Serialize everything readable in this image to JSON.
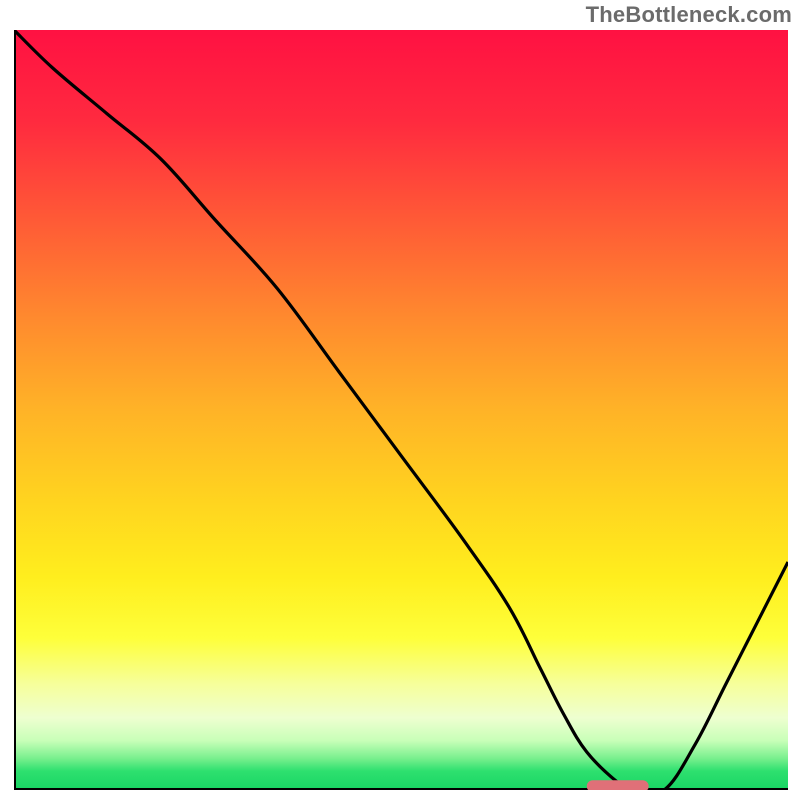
{
  "watermark": {
    "text": "TheBottleneck.com"
  },
  "colors": {
    "gradient_stops": [
      {
        "offset": 0.0,
        "color": "#ff1142"
      },
      {
        "offset": 0.12,
        "color": "#ff2a3f"
      },
      {
        "offset": 0.25,
        "color": "#ff5a36"
      },
      {
        "offset": 0.38,
        "color": "#ff8a2e"
      },
      {
        "offset": 0.5,
        "color": "#ffb327"
      },
      {
        "offset": 0.62,
        "color": "#ffd41f"
      },
      {
        "offset": 0.72,
        "color": "#ffee1e"
      },
      {
        "offset": 0.8,
        "color": "#feff3a"
      },
      {
        "offset": 0.86,
        "color": "#f6ff9a"
      },
      {
        "offset": 0.905,
        "color": "#eeffd0"
      },
      {
        "offset": 0.935,
        "color": "#c8ffb8"
      },
      {
        "offset": 0.958,
        "color": "#7af08e"
      },
      {
        "offset": 0.975,
        "color": "#2ee06f"
      },
      {
        "offset": 1.0,
        "color": "#18d563"
      }
    ],
    "curve_stroke": "#000000",
    "marker_fill": "#e07078",
    "axis_stroke": "#000000"
  },
  "chart_data": {
    "type": "line",
    "title": "",
    "xlabel": "",
    "ylabel": "",
    "xlim": [
      0,
      100
    ],
    "ylim": [
      0,
      100
    ],
    "x": [
      0,
      5,
      12,
      19,
      26,
      34,
      42,
      50,
      58,
      64,
      68,
      71,
      74,
      78,
      80,
      84,
      88,
      92,
      96,
      100
    ],
    "values": [
      100,
      95,
      89,
      83,
      75,
      66,
      55,
      44,
      33,
      24,
      16,
      10,
      5,
      1,
      0,
      0,
      6,
      14,
      22,
      30
    ],
    "marker": {
      "x_start": 74,
      "x_end": 82,
      "y": 0.5
    }
  }
}
